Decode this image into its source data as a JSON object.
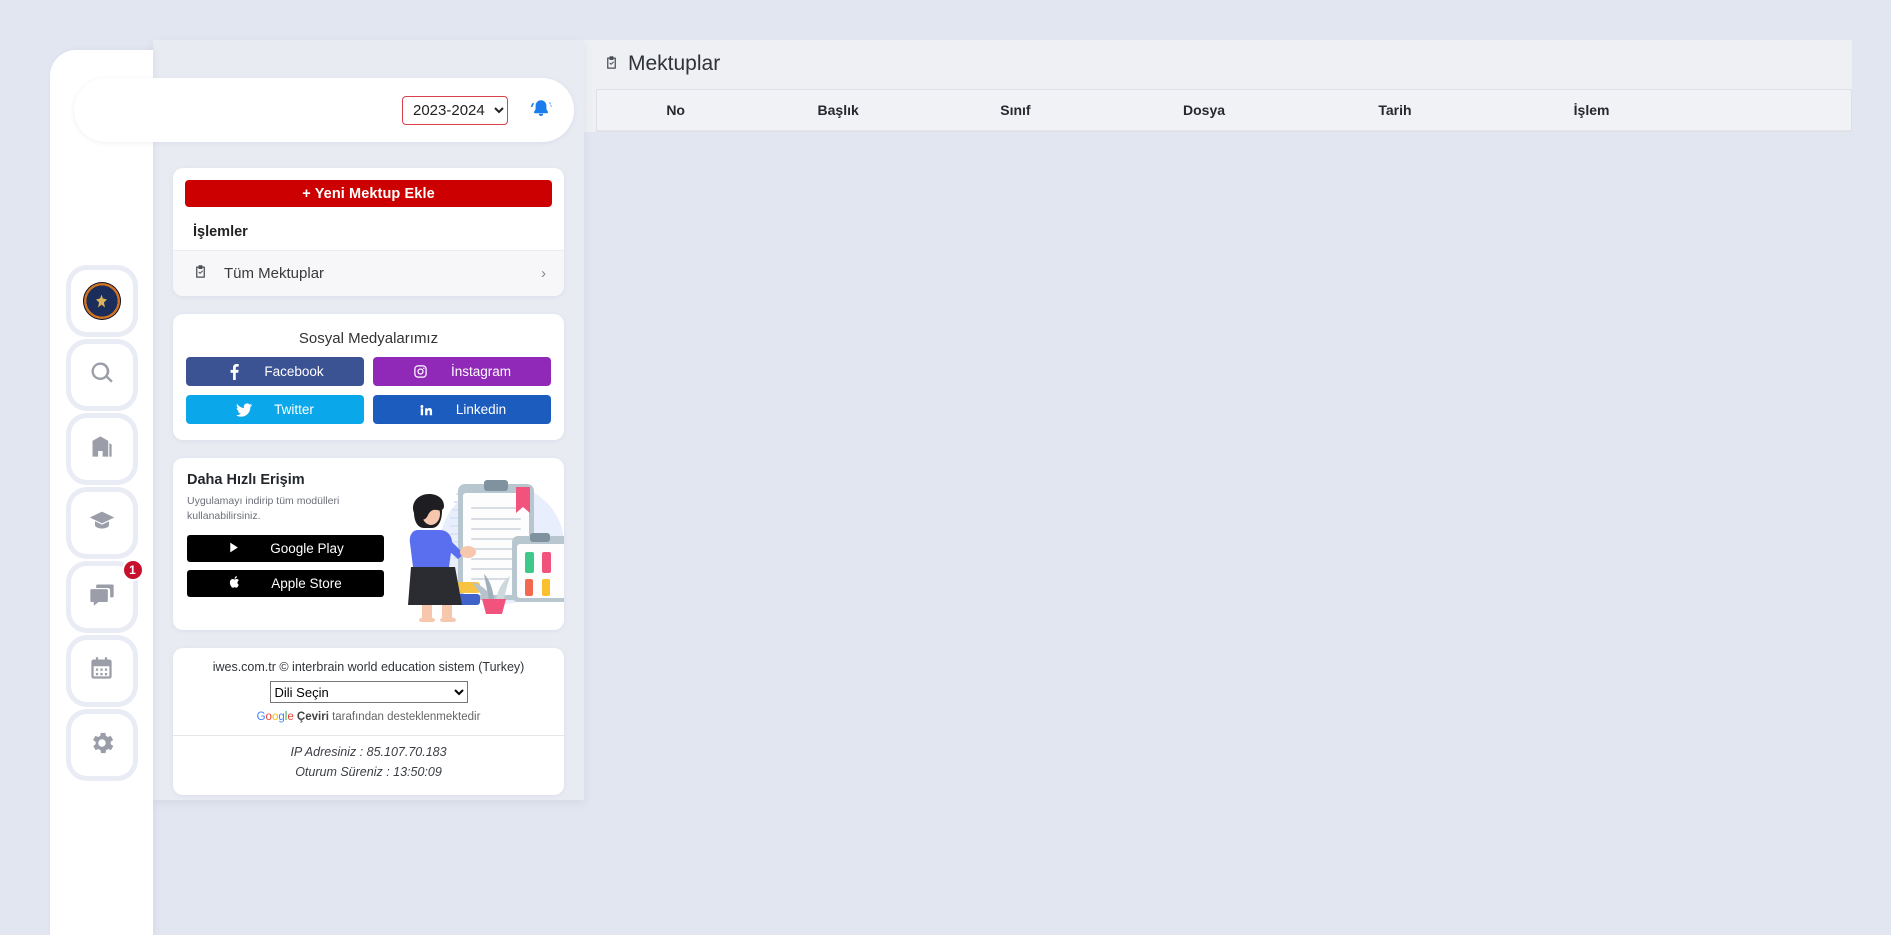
{
  "rail": {
    "items": [
      {
        "name": "school-logo",
        "icon": "school-emblem-icon",
        "badge": null
      },
      {
        "name": "search",
        "icon": "search-icon",
        "badge": null
      },
      {
        "name": "institution",
        "icon": "building-icon",
        "badge": null
      },
      {
        "name": "education",
        "icon": "graduation-cap-icon",
        "badge": null
      },
      {
        "name": "messages",
        "icon": "chat-bubbles-icon",
        "badge": "1"
      },
      {
        "name": "calendar",
        "icon": "calendar-icon",
        "badge": null
      },
      {
        "name": "settings",
        "icon": "gear-icon",
        "badge": null
      }
    ]
  },
  "header": {
    "year_value": "2023-2024",
    "year_options": [
      "2023-2024"
    ],
    "bell_icon": "notification-bell-icon"
  },
  "actions": {
    "new_letter_label": "Yeni Mektup Ekle",
    "new_letter_plus": "+",
    "section_title": "İşlemler",
    "menu": [
      {
        "label": "Tüm Mektuplar",
        "icon": "clipboard-check-icon",
        "chevron": "›"
      }
    ]
  },
  "social": {
    "title": "Sosyal Medyalarımız",
    "buttons": [
      {
        "label": "Facebook",
        "icon": "facebook-icon",
        "color": "#3b5293"
      },
      {
        "label": "İnstagram",
        "icon": "instagram-icon",
        "color": "#9129b8"
      },
      {
        "label": "Twitter",
        "icon": "twitter-icon",
        "color": "#0aa8ea"
      },
      {
        "label": "Linkedin",
        "icon": "linkedin-icon",
        "color": "#1c5cbe"
      }
    ]
  },
  "fast_access": {
    "title": "Daha Hızlı Erişim",
    "subtitle": "Uygulamayı indirip tüm modülleri kullanabilirsiniz.",
    "google_play_label": "Google Play",
    "apple_store_label": "Apple Store",
    "illustration": "woman-with-clipboard-illustration"
  },
  "footer": {
    "copyright": "iwes.com.tr © interbrain world education sistem (Turkey)",
    "lang_value": "Dili Seçin",
    "lang_options": [
      "Dili Seçin"
    ],
    "google_word": "Google",
    "translate_word": "Çeviri",
    "translate_rest": "tarafından desteklenmektedir",
    "ip_label": "IP Adresiniz : 85.107.70.183",
    "session_label": "Oturum Süreniz : 13:50:09"
  },
  "main": {
    "title": "Mektuplar",
    "title_icon": "clipboard-check-icon",
    "table": {
      "columns": [
        "No",
        "Başlık",
        "Sınıf",
        "Dosya",
        "Tarih",
        "İşlem"
      ],
      "rows": []
    }
  },
  "colors": {
    "page_bg": "#e2e6f0",
    "accent_red": "#cc0000",
    "badge_red": "#c8102e",
    "bell_blue": "#1b7ced"
  }
}
